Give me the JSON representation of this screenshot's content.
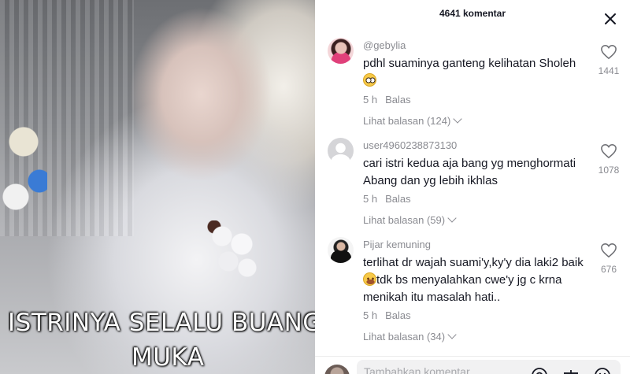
{
  "video": {
    "overlay_line1": "ISTRINYA SELALU BUANG",
    "overlay_line2": "MUKA"
  },
  "panel": {
    "title": "4641 komentar",
    "close_icon": "close-icon"
  },
  "comments": [
    {
      "author": "@gebylia",
      "text": "pdhl suaminya ganteng kelihatan Sholeh",
      "emoji": "pleading-face-emoji",
      "time": "5 h",
      "reply_label": "Balas",
      "likes": "1441",
      "replies_label": "Lihat balasan (124)"
    },
    {
      "author": "user4960238873130",
      "text": "cari istri kedua aja bang yg menghormati Abang dan yg lebih ikhlas",
      "time": "5 h",
      "reply_label": "Balas",
      "likes": "1078",
      "replies_label": "Lihat balasan (59)"
    },
    {
      "author": "Pijar kemuning",
      "text_before": "terlihat dr wajah suami'y,ky'y dia laki2 baik",
      "emoji": "smiling-face-emoji",
      "text_after": "tdk bs menyalahkan cwe'y jg c krna menikah itu masalah hati..",
      "time": "5 h",
      "reply_label": "Balas",
      "likes": "676",
      "replies_label": "Lihat balasan (34)"
    }
  ],
  "footer": {
    "placeholder": "Tambahkan komentar...",
    "icons": [
      "at-icon",
      "gift-icon",
      "emoji-icon"
    ]
  }
}
